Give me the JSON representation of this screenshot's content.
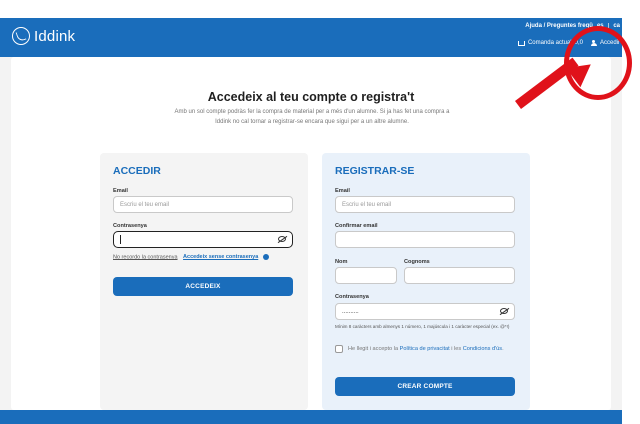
{
  "header": {
    "logo_text": "Iddink",
    "top_links": {
      "help": "Ajuda / Preguntes freqü",
      "lang_es": "es",
      "lang_ca": "ca"
    },
    "cart_label": "Comanda actual",
    "cart_amount": "0,0",
    "login_label": "Accedir"
  },
  "main": {
    "title": "Accedeix al teu compte o registra't",
    "subtitle": "Amb un sol compte podràs fer la compra de material per a més d'un alumne. Si ja has fet una compra a Iddink no cal tornar a registrar-se encara que sigui per a un altre alumne."
  },
  "login": {
    "title": "ACCEDIR",
    "email_label": "Email",
    "email_placeholder": "Escriu el teu email",
    "password_label": "Contrasenya",
    "forgot_link": "No recordo la contrasenya",
    "passwordless_link": "Accedeix sense contrasenya",
    "submit": "ACCEDEIX"
  },
  "register": {
    "title": "REGISTRAR-SE",
    "email_label": "Email",
    "email_placeholder": "Escriu el teu email",
    "confirm_email_label": "Confirmar email",
    "name_label": "Nom",
    "surname_label": "Cognoms",
    "password_label": "Contrasenya",
    "password_value": "..........",
    "password_hint": "Mínim 8 caràcters amb almenys 1 número, 1 majúscula i 1 caràcter especial (ex. @*!)",
    "consent_prefix": "He llegit i accepto la ",
    "consent_privacy": "Política de privacitat",
    "consent_mid": " i les ",
    "consent_terms": "Condicions d'ús",
    "consent_suffix": ".",
    "submit": "CREAR COMPTE"
  },
  "colors": {
    "brand": "#1a6dbb",
    "annotation": "#e0121a"
  }
}
